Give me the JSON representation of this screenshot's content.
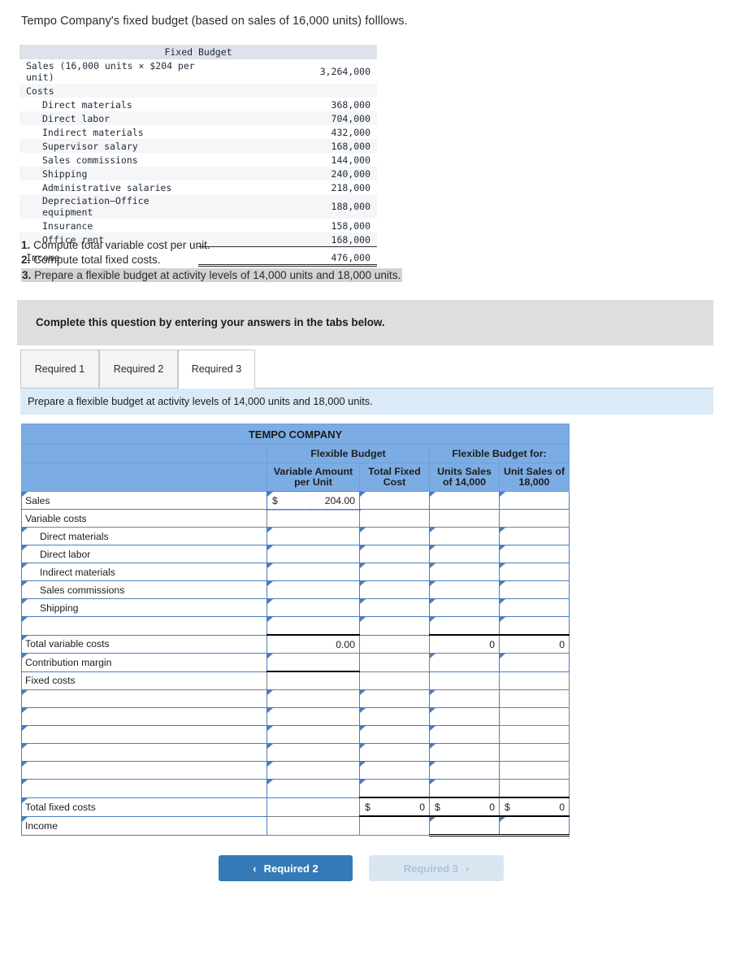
{
  "intro": "Tempo Company's fixed budget (based on sales of 16,000 units) folllows.",
  "fixed_budget": {
    "title": "Fixed Budget",
    "rows": [
      {
        "label": "Sales (16,000 units × $204 per unit)",
        "amount": "3,264,000",
        "indent": 0,
        "shade": false
      },
      {
        "label": "Costs",
        "amount": "",
        "indent": 0,
        "shade": true
      },
      {
        "label": "Direct materials",
        "amount": "368,000",
        "indent": 1,
        "shade": false
      },
      {
        "label": "Direct labor",
        "amount": "704,000",
        "indent": 1,
        "shade": true
      },
      {
        "label": "Indirect materials",
        "amount": "432,000",
        "indent": 1,
        "shade": false
      },
      {
        "label": "Supervisor salary",
        "amount": "168,000",
        "indent": 1,
        "shade": true
      },
      {
        "label": "Sales commissions",
        "amount": "144,000",
        "indent": 1,
        "shade": false
      },
      {
        "label": "Shipping",
        "amount": "240,000",
        "indent": 1,
        "shade": true
      },
      {
        "label": "Administrative salaries",
        "amount": "218,000",
        "indent": 1,
        "shade": false
      },
      {
        "label": "Depreciation—Office equipment",
        "amount": "188,000",
        "indent": 1,
        "shade": true
      },
      {
        "label": "Insurance",
        "amount": "158,000",
        "indent": 1,
        "shade": false
      },
      {
        "label": "Office rent",
        "amount": "168,000",
        "indent": 1,
        "shade": true
      },
      {
        "label": "Income",
        "amount": "476,000",
        "indent": 0,
        "shade": false
      }
    ]
  },
  "requirements": [
    {
      "num": "1.",
      "text": "Compute total variable cost per unit.",
      "highlight": false
    },
    {
      "num": "2.",
      "text": "Compute total fixed costs.",
      "highlight": false
    },
    {
      "num": "3.",
      "text": "Prepare a flexible budget at activity levels of 14,000 units and 18,000 units.",
      "highlight": true
    }
  ],
  "grey_banner": "Complete this question by entering your answers in the tabs below.",
  "tabs": [
    {
      "label": "Required 1",
      "active": false
    },
    {
      "label": "Required 2",
      "active": false
    },
    {
      "label": "Required 3",
      "active": true
    }
  ],
  "blue_banner": "Prepare a flexible budget at activity levels of 14,000 units and 18,000 units.",
  "spreadsheet": {
    "company": "TEMPO COMPANY",
    "group_headers": {
      "flexible_budget": "Flexible Budget",
      "flexible_budget_for": "Flexible Budget for:"
    },
    "columns": {
      "variable_amount": "Variable Amount per Unit",
      "total_fixed_cost": "Total Fixed Cost",
      "units_14000": "Units Sales of 14,000",
      "units_18000": "Unit Sales of 18,000"
    },
    "rows": {
      "sales": {
        "label": "Sales",
        "var_dollar": "$",
        "var_amount": "204.00",
        "fixed": "",
        "u14": "",
        "u18": ""
      },
      "variable_costs": {
        "label": "Variable costs"
      },
      "direct_materials": {
        "label": "Direct materials",
        "var_amount": "",
        "fixed": "",
        "u14": "",
        "u18": ""
      },
      "direct_labor": {
        "label": "Direct labor",
        "var_amount": "",
        "fixed": "",
        "u14": "",
        "u18": ""
      },
      "indirect_materials": {
        "label": "Indirect materials",
        "var_amount": "",
        "fixed": "",
        "u14": "",
        "u18": ""
      },
      "sales_commissions": {
        "label": "Sales commissions",
        "var_amount": "",
        "fixed": "",
        "u14": "",
        "u18": ""
      },
      "shipping": {
        "label": "Shipping",
        "var_amount": "",
        "fixed": "",
        "u14": "",
        "u18": ""
      },
      "blank_variable": {
        "label": "",
        "var_amount": "",
        "fixed": "",
        "u14": "",
        "u18": ""
      },
      "total_variable_costs": {
        "label": "Total variable costs",
        "var_amount": "0.00",
        "fixed": "",
        "u14": "0",
        "u18": "0"
      },
      "contribution_margin": {
        "label": "Contribution margin",
        "var_amount": "",
        "fixed": "",
        "u14": "",
        "u18": ""
      },
      "fixed_costs": {
        "label": "Fixed costs"
      },
      "fixed_blank_1": {
        "label": "",
        "var_amount": "",
        "fixed": "",
        "u14": "",
        "u18": ""
      },
      "fixed_blank_2": {
        "label": "",
        "var_amount": "",
        "fixed": "",
        "u14": "",
        "u18": ""
      },
      "fixed_blank_3": {
        "label": "",
        "var_amount": "",
        "fixed": "",
        "u14": "",
        "u18": ""
      },
      "fixed_blank_4": {
        "label": "",
        "var_amount": "",
        "fixed": "",
        "u14": "",
        "u18": ""
      },
      "fixed_blank_5": {
        "label": "",
        "var_amount": "",
        "fixed": "",
        "u14": "",
        "u18": ""
      },
      "fixed_blank_6": {
        "label": "",
        "var_amount": "",
        "fixed": "",
        "u14": "",
        "u18": ""
      },
      "total_fixed_costs": {
        "label": "Total fixed costs",
        "var_amount": "",
        "fixed_dollar": "$",
        "fixed": "0",
        "u14_dollar": "$",
        "u14": "0",
        "u18_dollar": "$",
        "u18": "0"
      },
      "income": {
        "label": "Income",
        "var_amount": "",
        "fixed": "",
        "u14": "",
        "u18": ""
      }
    }
  },
  "nav": {
    "prev_label": "Required 2",
    "prev_chevron": "‹",
    "next_label": "Required 3",
    "next_chevron": "›"
  },
  "colors": {
    "header_blue": "#7cace4",
    "banner_blue": "#daeaf7",
    "banner_grey": "#dededf",
    "button_blue": "#337ab7",
    "button_disabled": "#d9e6f2",
    "cell_outline": "#4a7ebb"
  }
}
